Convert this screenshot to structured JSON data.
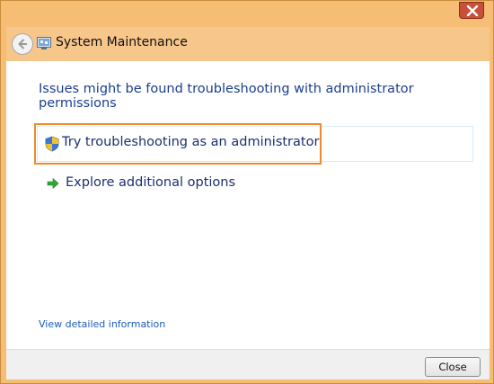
{
  "window": {
    "title": "System Maintenance"
  },
  "main": {
    "heading": "Issues might be found troubleshooting with administrator permissions",
    "options": [
      {
        "label": "Try troubleshooting as an administrator",
        "icon": "uac-shield-icon"
      },
      {
        "label": "Explore additional options",
        "icon": "green-arrow-icon"
      }
    ],
    "detail_link": "View detailed information"
  },
  "footer": {
    "close_label": "Close"
  },
  "colors": {
    "frame": "#f6bd74",
    "link": "#1b2f70",
    "heading": "#1b3e8e",
    "highlight": "#ee8a2a"
  }
}
